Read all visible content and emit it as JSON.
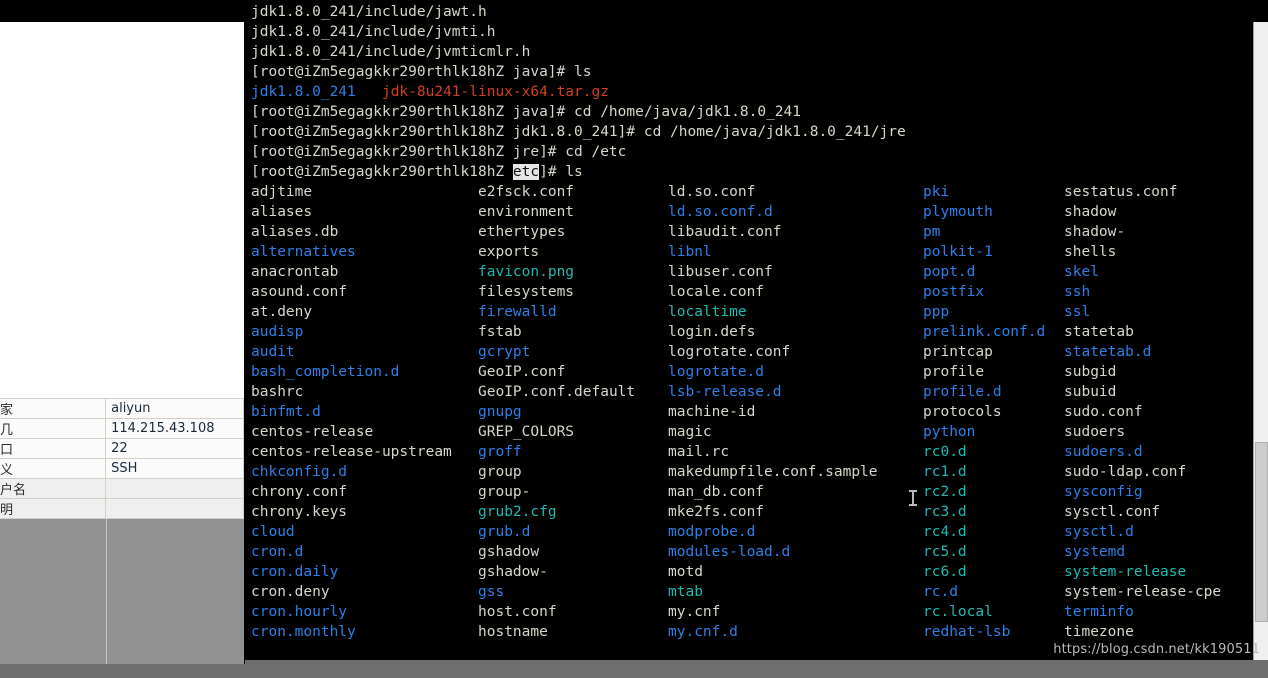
{
  "window": {
    "watermark": "https://blog.csdn.net/kk190511"
  },
  "session_panel": {
    "rows": [
      {
        "key": "家",
        "value": "aliyun"
      },
      {
        "key": "几",
        "value": "114.215.43.108"
      },
      {
        "key": "口",
        "value": "22"
      },
      {
        "key": "义",
        "value": "SSH"
      },
      {
        "key": "户名",
        "value": ""
      },
      {
        "key": "明",
        "value": ""
      }
    ]
  },
  "terminal": {
    "prompt_user": "[root@iZm5egagkkr290rthlk18hZ",
    "scrollback": [
      {
        "text": "jdk1.8.0_241/include/jawt.h",
        "cls": "w"
      },
      {
        "text": "jdk1.8.0_241/include/jvmti.h",
        "cls": "w"
      },
      {
        "text": "jdk1.8.0_241/include/jvmticmlr.h",
        "cls": "w"
      }
    ],
    "commands": [
      {
        "prompt": "[root@iZm5egagkkr290rthlk18hZ java]# ",
        "cmd": "ls"
      },
      {
        "prompt": "[root@iZm5egagkkr290rthlk18hZ java]# ",
        "cmd": "cd /home/java/jdk1.8.0_241"
      },
      {
        "prompt": "[root@iZm5egagkkr290rthlk18hZ jdk1.8.0_241]# ",
        "cmd": "cd /home/java/jdk1.8.0_241/jre"
      },
      {
        "prompt": "[root@iZm5egagkkr290rthlk18hZ jre]# ",
        "cmd": "cd /etc"
      }
    ],
    "ls_java_result": [
      {
        "name": "jdk1.8.0_241",
        "cls": "b"
      },
      {
        "name": "jdk-8u241-linux-x64.tar.gz",
        "cls": "r"
      }
    ],
    "final_prompt": {
      "before": "[root@iZm5egagkkr290rthlk18hZ ",
      "selected": "etc",
      "after": "]# ",
      "cmd": "ls"
    },
    "ls_etc_rows": [
      [
        {
          "n": "adjtime",
          "c": "w"
        },
        {
          "n": "e2fsck.conf",
          "c": "w"
        },
        {
          "n": "ld.so.conf",
          "c": "w"
        },
        {
          "n": "pki",
          "c": "b"
        },
        {
          "n": "sestatus.conf",
          "c": "w"
        }
      ],
      [
        {
          "n": "aliases",
          "c": "w"
        },
        {
          "n": "environment",
          "c": "w"
        },
        {
          "n": "ld.so.conf.d",
          "c": "b"
        },
        {
          "n": "plymouth",
          "c": "b"
        },
        {
          "n": "shadow",
          "c": "w"
        }
      ],
      [
        {
          "n": "aliases.db",
          "c": "w"
        },
        {
          "n": "ethertypes",
          "c": "w"
        },
        {
          "n": "libaudit.conf",
          "c": "w"
        },
        {
          "n": "pm",
          "c": "b"
        },
        {
          "n": "shadow-",
          "c": "w"
        }
      ],
      [
        {
          "n": "alternatives",
          "c": "b"
        },
        {
          "n": "exports",
          "c": "w"
        },
        {
          "n": "libnl",
          "c": "b"
        },
        {
          "n": "polkit-1",
          "c": "b"
        },
        {
          "n": "shells",
          "c": "w"
        }
      ],
      [
        {
          "n": "anacrontab",
          "c": "w"
        },
        {
          "n": "favicon.png",
          "c": "cy"
        },
        {
          "n": "libuser.conf",
          "c": "w"
        },
        {
          "n": "popt.d",
          "c": "b"
        },
        {
          "n": "skel",
          "c": "b"
        }
      ],
      [
        {
          "n": "asound.conf",
          "c": "w"
        },
        {
          "n": "filesystems",
          "c": "w"
        },
        {
          "n": "locale.conf",
          "c": "w"
        },
        {
          "n": "postfix",
          "c": "b"
        },
        {
          "n": "ssh",
          "c": "b"
        }
      ],
      [
        {
          "n": "at.deny",
          "c": "w"
        },
        {
          "n": "firewalld",
          "c": "b"
        },
        {
          "n": "localtime",
          "c": "cy"
        },
        {
          "n": "ppp",
          "c": "b"
        },
        {
          "n": "ssl",
          "c": "b"
        }
      ],
      [
        {
          "n": "audisp",
          "c": "b"
        },
        {
          "n": "fstab",
          "c": "w"
        },
        {
          "n": "login.defs",
          "c": "w"
        },
        {
          "n": "prelink.conf.d",
          "c": "b"
        },
        {
          "n": "statetab",
          "c": "w"
        }
      ],
      [
        {
          "n": "audit",
          "c": "b"
        },
        {
          "n": "gcrypt",
          "c": "b"
        },
        {
          "n": "logrotate.conf",
          "c": "w"
        },
        {
          "n": "printcap",
          "c": "w"
        },
        {
          "n": "statetab.d",
          "c": "b"
        }
      ],
      [
        {
          "n": "bash_completion.d",
          "c": "b"
        },
        {
          "n": "GeoIP.conf",
          "c": "w"
        },
        {
          "n": "logrotate.d",
          "c": "b"
        },
        {
          "n": "profile",
          "c": "w"
        },
        {
          "n": "subgid",
          "c": "w"
        }
      ],
      [
        {
          "n": "bashrc",
          "c": "w"
        },
        {
          "n": "GeoIP.conf.default",
          "c": "w"
        },
        {
          "n": "lsb-release.d",
          "c": "b"
        },
        {
          "n": "profile.d",
          "c": "b"
        },
        {
          "n": "subuid",
          "c": "w"
        }
      ],
      [
        {
          "n": "binfmt.d",
          "c": "b"
        },
        {
          "n": "gnupg",
          "c": "b"
        },
        {
          "n": "machine-id",
          "c": "w"
        },
        {
          "n": "protocols",
          "c": "w"
        },
        {
          "n": "sudo.conf",
          "c": "w"
        }
      ],
      [
        {
          "n": "centos-release",
          "c": "w"
        },
        {
          "n": "GREP_COLORS",
          "c": "w"
        },
        {
          "n": "magic",
          "c": "w"
        },
        {
          "n": "python",
          "c": "b"
        },
        {
          "n": "sudoers",
          "c": "w"
        }
      ],
      [
        {
          "n": "centos-release-upstream",
          "c": "w"
        },
        {
          "n": "groff",
          "c": "b"
        },
        {
          "n": "mail.rc",
          "c": "w"
        },
        {
          "n": "rc0.d",
          "c": "cy"
        },
        {
          "n": "sudoers.d",
          "c": "b"
        }
      ],
      [
        {
          "n": "chkconfig.d",
          "c": "b"
        },
        {
          "n": "group",
          "c": "w"
        },
        {
          "n": "makedumpfile.conf.sample",
          "c": "w"
        },
        {
          "n": "rc1.d",
          "c": "cy"
        },
        {
          "n": "sudo-ldap.conf",
          "c": "w"
        }
      ],
      [
        {
          "n": "chrony.conf",
          "c": "w"
        },
        {
          "n": "group-",
          "c": "w"
        },
        {
          "n": "man_db.conf",
          "c": "w"
        },
        {
          "n": "rc2.d",
          "c": "cy"
        },
        {
          "n": "sysconfig",
          "c": "b"
        }
      ],
      [
        {
          "n": "chrony.keys",
          "c": "w"
        },
        {
          "n": "grub2.cfg",
          "c": "cy"
        },
        {
          "n": "mke2fs.conf",
          "c": "w"
        },
        {
          "n": "rc3.d",
          "c": "cy"
        },
        {
          "n": "sysctl.conf",
          "c": "w"
        }
      ],
      [
        {
          "n": "cloud",
          "c": "b"
        },
        {
          "n": "grub.d",
          "c": "b"
        },
        {
          "n": "modprobe.d",
          "c": "b"
        },
        {
          "n": "rc4.d",
          "c": "cy"
        },
        {
          "n": "sysctl.d",
          "c": "b"
        }
      ],
      [
        {
          "n": "cron.d",
          "c": "b"
        },
        {
          "n": "gshadow",
          "c": "w"
        },
        {
          "n": "modules-load.d",
          "c": "b"
        },
        {
          "n": "rc5.d",
          "c": "cy"
        },
        {
          "n": "systemd",
          "c": "b"
        }
      ],
      [
        {
          "n": "cron.daily",
          "c": "b"
        },
        {
          "n": "gshadow-",
          "c": "w"
        },
        {
          "n": "motd",
          "c": "w"
        },
        {
          "n": "rc6.d",
          "c": "cy"
        },
        {
          "n": "system-release",
          "c": "cy"
        }
      ],
      [
        {
          "n": "cron.deny",
          "c": "w"
        },
        {
          "n": "gss",
          "c": "b"
        },
        {
          "n": "mtab",
          "c": "cy"
        },
        {
          "n": "rc.d",
          "c": "b"
        },
        {
          "n": "system-release-cpe",
          "c": "w"
        }
      ],
      [
        {
          "n": "cron.hourly",
          "c": "b"
        },
        {
          "n": "host.conf",
          "c": "w"
        },
        {
          "n": "my.cnf",
          "c": "w"
        },
        {
          "n": "rc.local",
          "c": "cy"
        },
        {
          "n": "terminfo",
          "c": "b"
        }
      ],
      [
        {
          "n": "cron.monthly",
          "c": "b"
        },
        {
          "n": "hostname",
          "c": "w"
        },
        {
          "n": "my.cnf.d",
          "c": "b"
        },
        {
          "n": "redhat-lsb",
          "c": "b"
        },
        {
          "n": "timezone",
          "c": "w"
        }
      ]
    ]
  }
}
